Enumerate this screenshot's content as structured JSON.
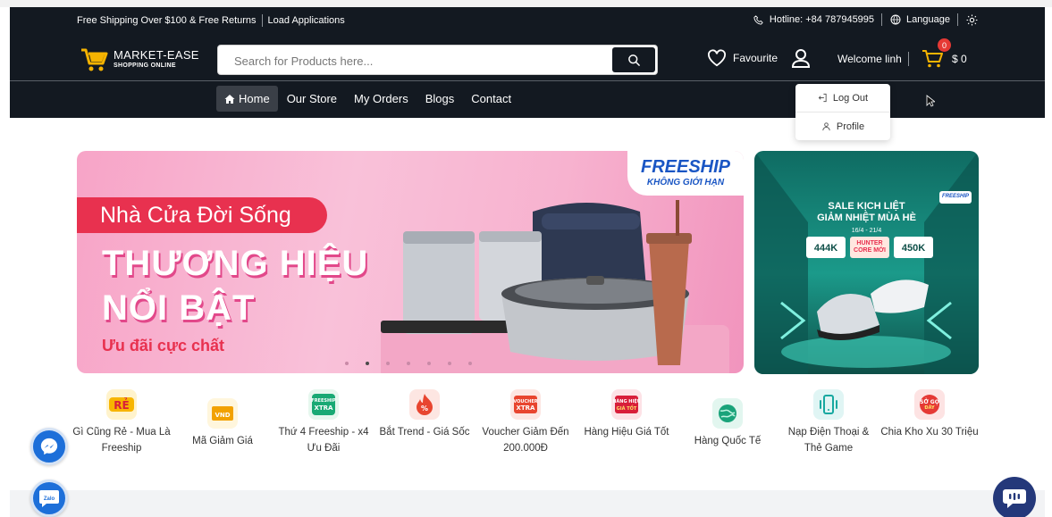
{
  "topbar": {
    "shipping_text": "Free Shipping Over $100 & Free Returns",
    "apps_link": "Load Applications",
    "hotline_label": "Hotline: +84 787945995",
    "language_label": "Language"
  },
  "header": {
    "brand": "MARKET-EASE",
    "tagline": "SHOPPING ONLINE",
    "search_placeholder": "Search for Products here...",
    "favourite_label": "Favourite",
    "welcome_text": "Welcome linh",
    "cart_count": "0",
    "cart_total": "$ 0"
  },
  "nav": {
    "items": [
      {
        "label": "Home",
        "active": true
      },
      {
        "label": "Our Store"
      },
      {
        "label": "My Orders"
      },
      {
        "label": "Blogs"
      },
      {
        "label": "Contact"
      }
    ]
  },
  "user_menu": {
    "logout_label": "Log Out",
    "profile_label": "Profile"
  },
  "hero": {
    "pill_text": "Nhà Cửa Đời Sống",
    "headline_1": "THƯƠNG HIỆU",
    "headline_2": "NỔI BẬT",
    "subtext": "Ưu đãi cực chất",
    "badge_1": "FREESHIP",
    "badge_2": "KHÔNG GIỚI HẠN",
    "slide_count": 7,
    "active_slide": 1
  },
  "side_banner": {
    "title_1": "SALE KỊCH LIỆT",
    "title_2": "GIẢM NHIỆT MÙA HÈ",
    "date": "16/4 - 21/4",
    "voucher_1": "444K",
    "voucher_mid": "HUNTER CORE MỚI",
    "voucher_2": "450K",
    "badge": "FREESHIP"
  },
  "categories": [
    {
      "label": "Gì Cũng Rẻ - Mua Là Freeship",
      "icon": "re-tag-icon",
      "color": "#f7b500"
    },
    {
      "label": "Mã Giảm Giá",
      "icon": "voucher-icon",
      "color": "#f2a100"
    },
    {
      "label": "Thứ 4 Freeship - x4 Ưu Đãi",
      "icon": "freeship-xtra-icon",
      "color": "#19a974"
    },
    {
      "label": "Bắt Trend - Giá Sốc",
      "icon": "fire-deal-icon",
      "color": "#e8452f"
    },
    {
      "label": "Voucher Giảm Đến 200.000Đ",
      "icon": "voucher-xtra-icon",
      "color": "#e8452f"
    },
    {
      "label": "Hàng Hiệu Giá Tốt",
      "icon": "brand-price-icon",
      "color": "#d81e3a"
    },
    {
      "label": "Hàng Quốc Tế",
      "icon": "globe-icon",
      "color": "#1aa37a"
    },
    {
      "label": "Nạp Điện Thoại & Thẻ Game",
      "icon": "phone-topup-icon",
      "color": "#16a8a0"
    },
    {
      "label": "Chia Kho Xu 30 Triệu",
      "icon": "coin-icon",
      "color": "#e53935"
    }
  ],
  "floating": {
    "zalo_label": "Zalo"
  }
}
